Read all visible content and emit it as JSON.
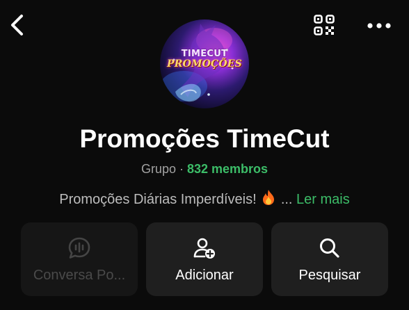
{
  "header": {
    "back_icon": "chevron-left-icon",
    "qr_icon": "qr-code-icon",
    "more_icon": "more-horizontal-icon"
  },
  "avatar": {
    "line1": "TIMECUT",
    "line2": "PROMOÇÕES"
  },
  "group": {
    "name": "Promoções TimeCut",
    "type_label": "Grupo",
    "separator": "·",
    "members": "832 membros",
    "description": "Promoções Diárias Imperdíveis!",
    "description_emoji_icon": "fire-emoji-icon",
    "ellipsis": "...",
    "read_more": "Ler mais"
  },
  "actions": [
    {
      "label": "Conversa Po...",
      "icon": "voice-chat-icon",
      "enabled": false
    },
    {
      "label": "Adicionar",
      "icon": "add-person-icon",
      "enabled": true
    },
    {
      "label": "Pesquisar",
      "icon": "search-icon",
      "enabled": true
    }
  ],
  "colors": {
    "background": "#0b0b0b",
    "accent_green": "#3cbd68",
    "card": "#1f1f1f",
    "muted_text": "#a2a2a2"
  }
}
